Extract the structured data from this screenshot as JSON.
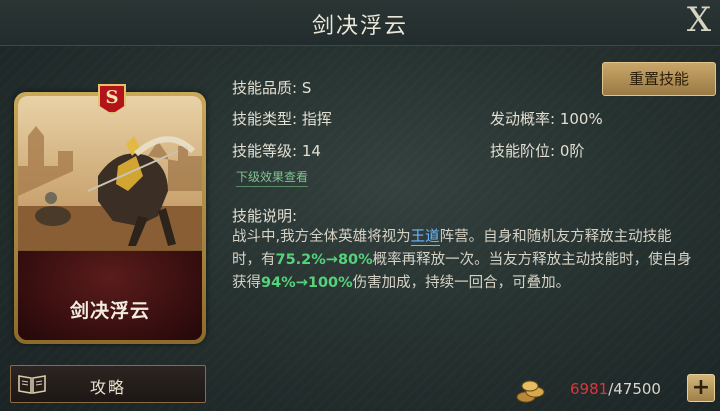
{
  "header": {
    "title": "剑决浮云",
    "close_label": "X"
  },
  "card": {
    "grade_letter": "S",
    "name": "剑决浮云",
    "emblem_icon": "faction-emblem-icon"
  },
  "info": {
    "quality": "技能品质: S",
    "type": "技能类型: 指挥",
    "level": "技能等级: 14",
    "trigger_rate": "发动概率: 100%",
    "rank": "技能阶位: 0阶",
    "lower_effect_link": "下级效果查看",
    "reset_button": "重置技能"
  },
  "description": {
    "title": "技能说明:",
    "part1": "战斗中,我方全体英雄将视为",
    "faction": "王道",
    "part2": "阵营。自身和随机友方释放主动技能时，有",
    "chance_range": "75.2%→80%",
    "part3": "概率再释放一次。当友方释放主动技能时，使自身获得",
    "damage_range": "94%→100%",
    "part4": "伤害加成，持续一回合，可叠加。"
  },
  "footer": {
    "guide_label": "攻略",
    "resource_current": "6981",
    "resource_sep_total": "/47500",
    "plus_label": "+",
    "coin_icon": "coin-pile-icon",
    "book_icon": "book-icon"
  },
  "colors": {
    "highlight_blue": "#69b7ff",
    "highlight_green": "#55d37a",
    "resource_red": "#e0343a",
    "gold_button": "#c9a76a"
  }
}
